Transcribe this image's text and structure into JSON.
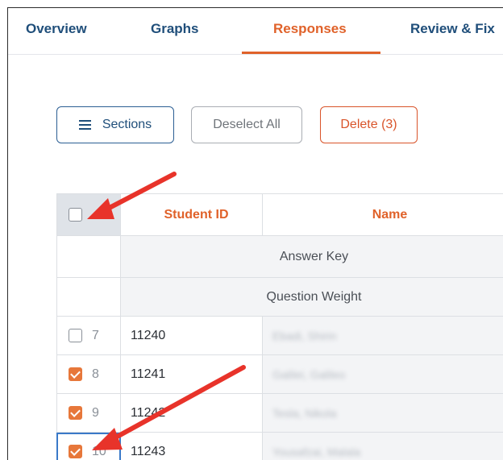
{
  "tabs": [
    {
      "label": "Overview",
      "active": false
    },
    {
      "label": "Graphs",
      "active": false
    },
    {
      "label": "Responses",
      "active": true
    },
    {
      "label": "Review & Fix",
      "active": false
    }
  ],
  "toolbar": {
    "sections_label": "Sections",
    "deselect_label": "Deselect All",
    "delete_label": "Delete (3)"
  },
  "table": {
    "headers": {
      "student_id": "Student ID",
      "name": "Name"
    },
    "answer_key_label": "Answer Key",
    "question_weight_label": "Question Weight",
    "rows": [
      {
        "num": "7",
        "student_id": "11240",
        "name": "Ebadi, Shirin",
        "checked": false
      },
      {
        "num": "8",
        "student_id": "11241",
        "name": "Galilei, Galileo",
        "checked": true
      },
      {
        "num": "9",
        "student_id": "11242",
        "name": "Tesla, Nikola",
        "checked": true
      },
      {
        "num": "10",
        "student_id": "11243",
        "name": "Yousafzai, Malala",
        "checked": true
      }
    ]
  },
  "colors": {
    "accent": "#e0622a",
    "primary": "#1f4e7a",
    "arrow": "#e8332a"
  }
}
